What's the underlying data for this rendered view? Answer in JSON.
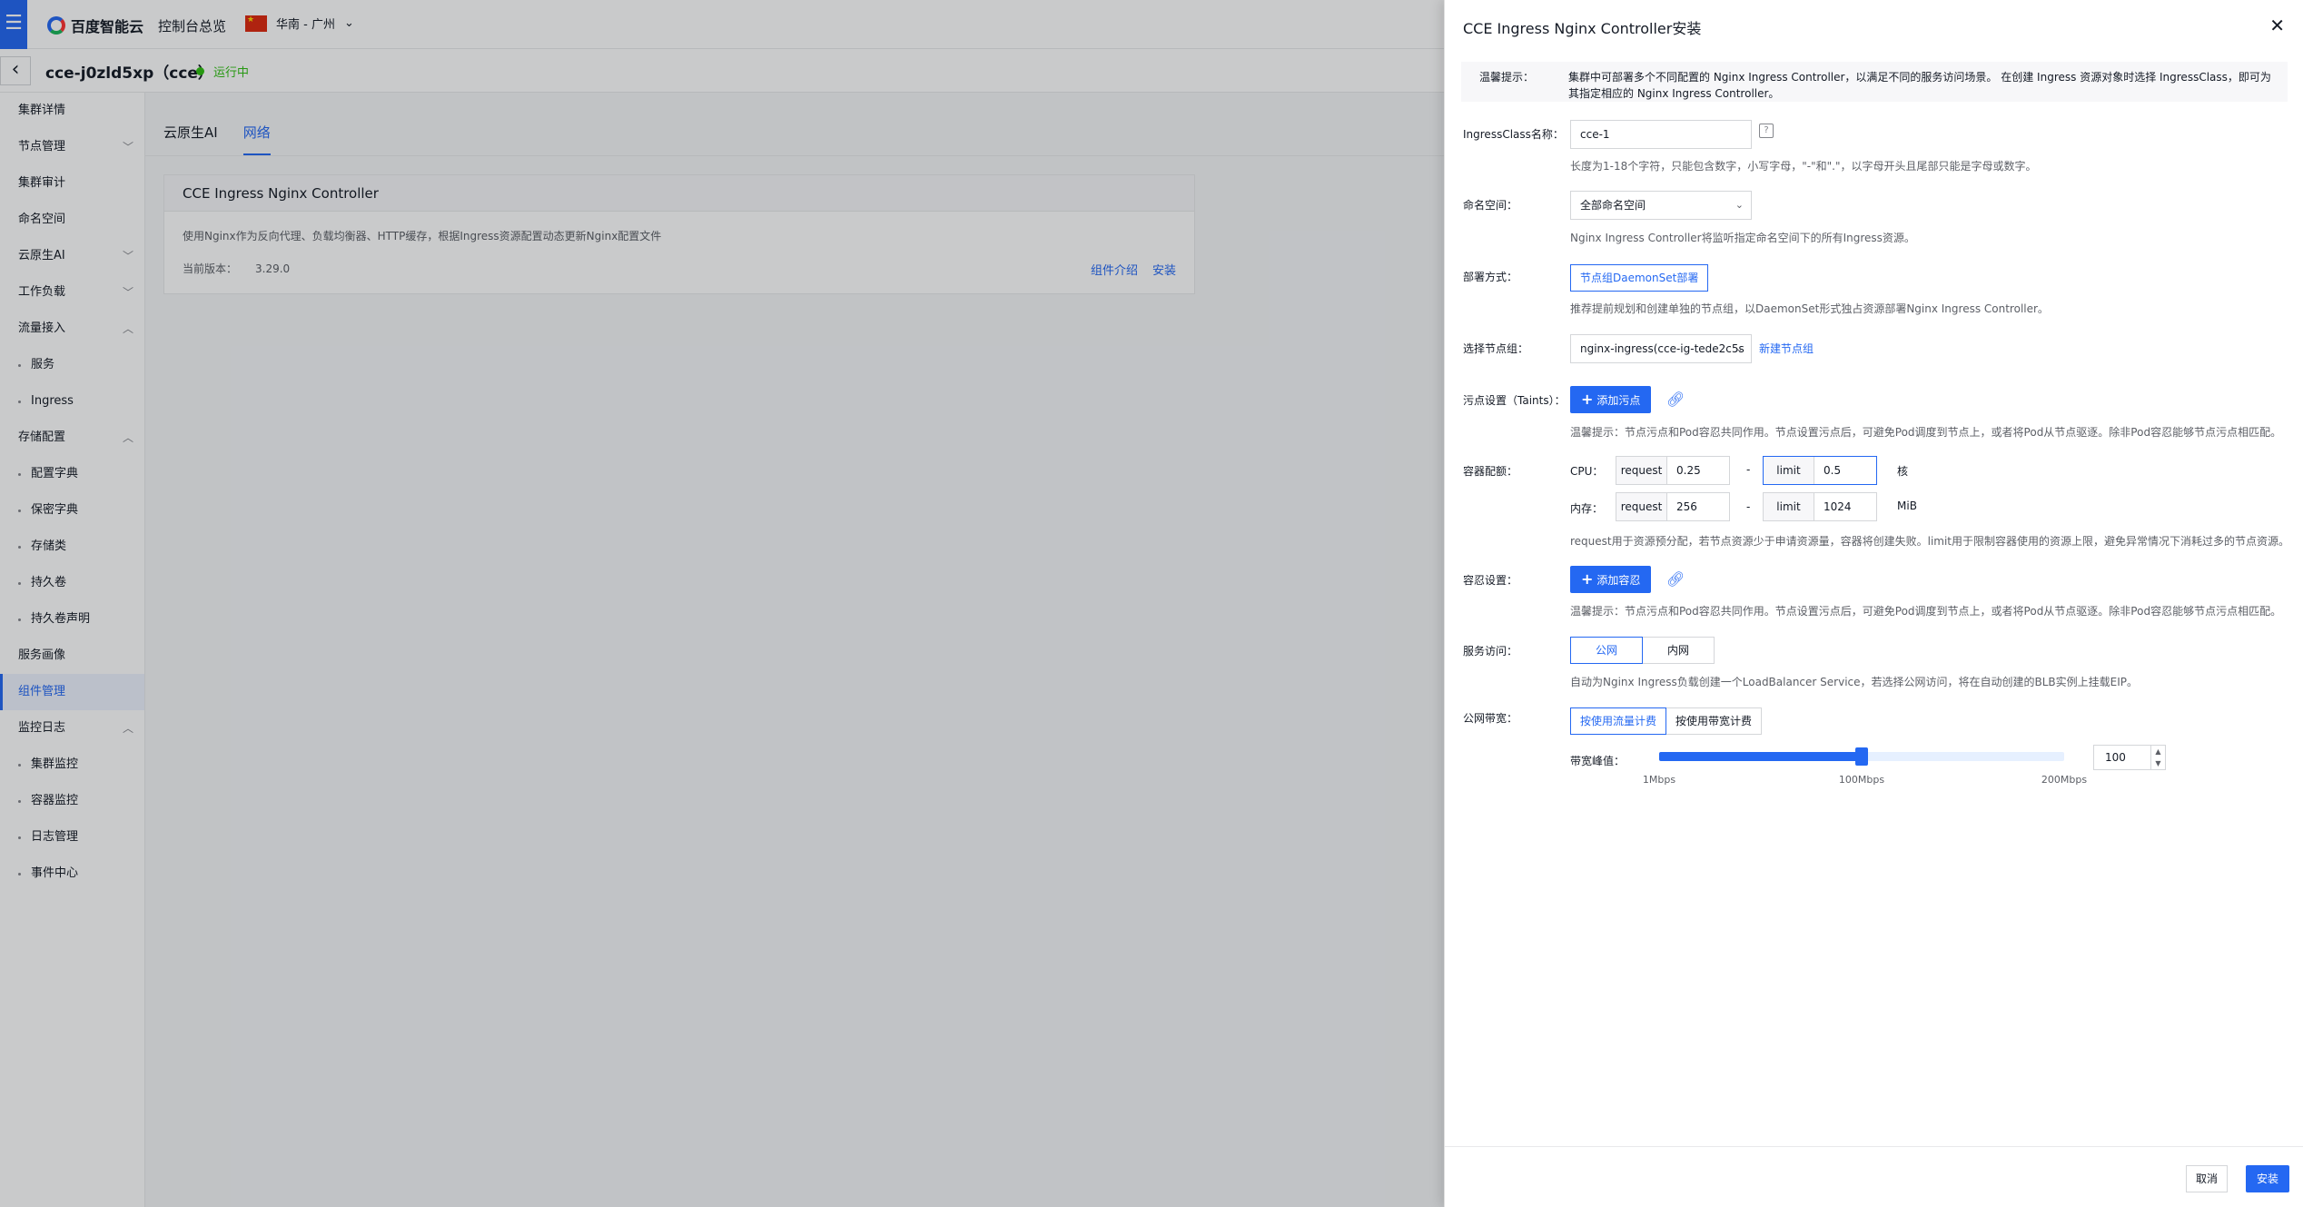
{
  "topbar": {
    "brand": "百度智能云",
    "console_link": "控制台总览",
    "region": "华南 - 广州"
  },
  "subheader": {
    "cluster_name": "cce-j0zld5xp（cce）",
    "status": "运行中"
  },
  "sidebar": {
    "items": [
      {
        "label": "集群详情",
        "type": "item"
      },
      {
        "label": "节点管理",
        "type": "group",
        "expanded": false
      },
      {
        "label": "集群审计",
        "type": "item"
      },
      {
        "label": "命名空间",
        "type": "item"
      },
      {
        "label": "云原生AI",
        "type": "group",
        "expanded": false
      },
      {
        "label": "工作负载",
        "type": "group",
        "expanded": false
      },
      {
        "label": "流量接入",
        "type": "group",
        "expanded": true
      },
      {
        "label": "服务",
        "type": "sub"
      },
      {
        "label": "Ingress",
        "type": "sub"
      },
      {
        "label": "存储配置",
        "type": "group",
        "expanded": true
      },
      {
        "label": "配置字典",
        "type": "sub"
      },
      {
        "label": "保密字典",
        "type": "sub"
      },
      {
        "label": "存储类",
        "type": "sub"
      },
      {
        "label": "持久卷",
        "type": "sub"
      },
      {
        "label": "持久卷声明",
        "type": "sub"
      },
      {
        "label": "服务画像",
        "type": "item"
      },
      {
        "label": "组件管理",
        "type": "item",
        "active": true
      },
      {
        "label": "监控日志",
        "type": "group",
        "expanded": true
      },
      {
        "label": "集群监控",
        "type": "sub"
      },
      {
        "label": "容器监控",
        "type": "sub"
      },
      {
        "label": "日志管理",
        "type": "sub"
      },
      {
        "label": "事件中心",
        "type": "sub"
      }
    ]
  },
  "main": {
    "tabs": [
      {
        "label": "云原生AI",
        "active": false
      },
      {
        "label": "网络",
        "active": true
      }
    ],
    "card": {
      "title": "CCE Ingress Nginx Controller",
      "desc": "使用Nginx作为反向代理、负载均衡器、HTTP缓存，根据Ingress资源配置动态更新Nginx配置文件",
      "version_label": "当前版本：",
      "version": "3.29.0",
      "link_intro": "组件介绍",
      "link_install": "安装"
    }
  },
  "drawer": {
    "title": "CCE Ingress Nginx Controller安装",
    "tip_label": "温馨提示：",
    "tip_text": "集群中可部署多个不同配置的 Nginx Ingress Controller，以满足不同的服务访问场景。 在创建 Ingress 资源对象时选择 IngressClass，即可为其指定相应的 Nginx Ingress Controller。",
    "ingress_class": {
      "label": "IngressClass名称：",
      "value": "cce-1",
      "help": "长度为1-18个字符，只能包含数字，小写字母，\"-\"和\".\"，以字母开头且尾部只能是字母或数字。"
    },
    "namespace": {
      "label": "命名空间：",
      "value": "全部命名空间",
      "help": "Nginx Ingress Controller将监听指定命名空间下的所有Ingress资源。"
    },
    "deploy": {
      "label": "部署方式：",
      "value": "节点组DaemonSet部署",
      "help": "推荐提前规划和创建单独的节点组，以DaemonSet形式独占资源部署Nginx Ingress Controller。"
    },
    "node_group": {
      "label": "选择节点组：",
      "value": "nginx-ingress(cce-ig-tede2c5s",
      "new_link": "新建节点组"
    },
    "taints": {
      "label": "污点设置（Taints）：",
      "button": "添加污点",
      "help": "温馨提示：节点污点和Pod容忍共同作用。节点设置污点后，可避免Pod调度到节点上，或者将Pod从节点驱逐。除非Pod容忍能够节点污点相匹配。"
    },
    "quota": {
      "label": "容器配额：",
      "cpu_label": "CPU：",
      "mem_label": "内存：",
      "request_tag": "request",
      "limit_tag": "limit",
      "cpu_request": "0.25",
      "cpu_limit": "0.5",
      "cpu_unit": "核",
      "mem_request": "256",
      "mem_limit": "1024",
      "mem_unit": "MiB",
      "dash": "-",
      "help": "request用于资源预分配，若节点资源少于申请资源量，容器将创建失败。limit用于限制容器使用的资源上限，避免异常情况下消耗过多的节点资源。"
    },
    "tolerations": {
      "label": "容忍设置：",
      "button": "添加容忍",
      "help": "温馨提示：节点污点和Pod容忍共同作用。节点设置污点后，可避免Pod调度到节点上，或者将Pod从节点驱逐。除非Pod容忍能够节点污点相匹配。"
    },
    "service_access": {
      "label": "服务访问：",
      "options": [
        "公网",
        "内网"
      ],
      "selected": "公网",
      "help": "自动为Nginx Ingress负载创建一个LoadBalancer Service，若选择公网访问，将在自动创建的BLB实例上挂载EIP。"
    },
    "bandwidth": {
      "label": "公网带宽：",
      "options": [
        "按使用流量计费",
        "按使用带宽计费"
      ],
      "selected": "按使用流量计费",
      "peak_label": "带宽峰值：",
      "value": "100",
      "fraction": 0.5,
      "tick_min": "1Mbps",
      "tick_mid": "100Mbps",
      "tick_max": "200Mbps"
    },
    "footer": {
      "cancel": "取消",
      "install": "安装"
    }
  },
  "colors": {
    "primary": "#2468f2",
    "success": "#30bf13"
  }
}
